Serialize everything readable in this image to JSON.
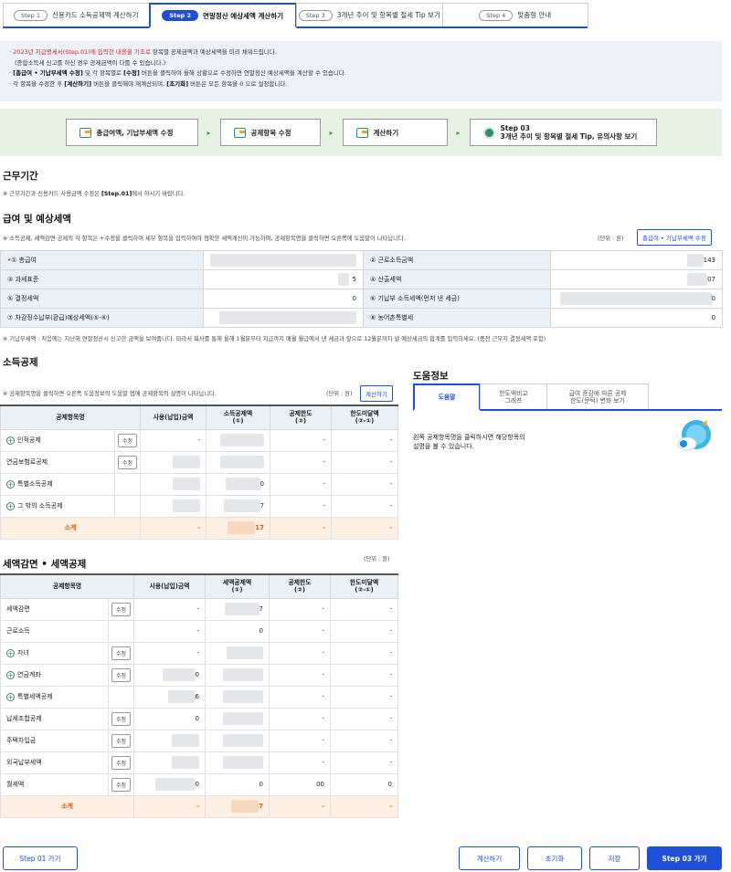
{
  "tabs": [
    {
      "step": "Step 1",
      "label": "신용카드 소득공제액 계산하기"
    },
    {
      "step": "Step 2",
      "label": "연말정산 예상세액 계산하기"
    },
    {
      "step": "Step 3",
      "label": "3개년 추이 및 항목별 절세 Tip 보기"
    },
    {
      "step": "Step 4",
      "label": "맞춤형 안내"
    }
  ],
  "notice": {
    "l1_red": "2023년 지급명세서(Step.01)에 입력한 내용을 기초로",
    "l1_rest": " 항목별 공제금액과 예상세액을 미리 채워드립니다.",
    "l2": "(종합소득세 신고를 하신 경우 공제금액이 다를 수 있습니다.)",
    "l3_b1": "[총급여 • 기납부세액 수정]",
    "l3_m1": " 및 각 항목별로 ",
    "l3_b2": "[수정]",
    "l3_m2": " 버튼을 클릭하여 올해 상황으로 수정하면 연말정산 예상세액을 계산할 수 있습니다.",
    "l4_a": "각 항목을 수정한 후 ",
    "l4_b1": "[계산하기]",
    "l4_m": " 버튼을 클릭해야 재계산되며, ",
    "l4_b2": "[초기화]",
    "l4_c": " 버튼은 모든 항목을 0 으로 설정합니다."
  },
  "flow": {
    "b1": "총급여액, 기납부세액 수정",
    "b2": "공제항목 수정",
    "b3": "계산하기",
    "b4_top": "Step 03",
    "b4_bot": "3개년 추이 및 항목별 절세 Tip, 유의사항 보기"
  },
  "work": {
    "title": "근무기간",
    "note_a": "※ 근무기간과 신용카드 사용금액 수정은 ",
    "note_b": "[Step.01]",
    "note_c": "에서 하시기 바랍니다."
  },
  "salary": {
    "title": "급여 및 예상세액",
    "note": "※ 소득공제, 세액감면·공제의 각 항목은 +수정을 클릭하여 세부 항목을 입력하여야 정확한 세액계산이 가능하며, 공제항목명을 클릭하면 오른쪽에 도움말이 나타납니다.",
    "unit": "(단위 : 원)",
    "edit_btn": "총급여 • 기납부세액 수정",
    "rows": [
      {
        "l1": "① 총급여",
        "v1": "",
        "l2": "② 근로소득금액",
        "v2": "143"
      },
      {
        "l1": "③ 과세표준",
        "v1": "5",
        "l2": "④ 산출세액",
        "v2": "07"
      },
      {
        "l1": "⑤ 결정세액",
        "v1": "0",
        "l2": "⑥ 기납부 소득세액(먼저 낸 세금)",
        "v2": "0"
      },
      {
        "l1": "⑦ 차감징수납부(환급)예상세액(⑤-⑥)",
        "v1": "",
        "l2": "⑧ 농어촌특별세",
        "v2": "0"
      }
    ],
    "star": "•",
    "footnote": "※ 기납부세액 : 처음에는 지난해 연말정산시 신고한 금액을 보여줍니다. 따라서 회사를 통해 올해 1월분부터 지급까지 매월 월급에서 낸 세금과 앞으로 12월분까지 낼 예상세금의 합계를 입력하세요. (중전 근무지 결정세액 포함)"
  },
  "income": {
    "title": "소득공제",
    "note": "※ 공제항목명을 클릭하면 오른쪽 도움정보의 도움말 탭에 공제항목의 설명이 나타납니다.",
    "unit": "(단위 : 원)",
    "calc_btn": "계산하기",
    "headers": [
      "공제항목명",
      "사용(납입)금액",
      "소득공제액\n(①)",
      "공제한도\n(②)",
      "한도미달액\n(②-①)"
    ],
    "rows": [
      {
        "name": "인적공제",
        "plus": true,
        "edit": "수정",
        "used": "-",
        "amt": "",
        "limit": "-",
        "short": "-"
      },
      {
        "name": "연금보험료공제",
        "plus": false,
        "edit": "수정",
        "used": "",
        "amt": "",
        "limit": "-",
        "short": "-"
      },
      {
        "name": "특별소득공제",
        "plus": true,
        "edit": "",
        "used": "",
        "amt": "0",
        "limit": "-",
        "short": "-"
      },
      {
        "name": "그 밖의 소득공제",
        "plus": true,
        "edit": "",
        "used": "",
        "amt": "7",
        "limit": "-",
        "short": "-"
      }
    ],
    "subtotal": {
      "label": "소계",
      "used": "-",
      "amt": "17",
      "limit": "-",
      "short": "-"
    }
  },
  "tax": {
    "title": "세액감면 • 세액공제",
    "unit": "(단위 : 원)",
    "headers": [
      "공제항목명",
      "사용(납입)금액",
      "세액공제액\n(①)",
      "공제한도\n(②)",
      "한도미달액\n(②-①)"
    ],
    "rows": [
      {
        "name": "세액감면",
        "plus": false,
        "edit": "수정",
        "used": "-",
        "amt": "7",
        "limit": "-",
        "short": "-"
      },
      {
        "name": "근로소득",
        "plus": false,
        "edit": "",
        "used": "-",
        "amt": "0",
        "limit": "-",
        "short": "-"
      },
      {
        "name": "자녀",
        "plus": true,
        "edit": "수정",
        "used": "-",
        "amt": "",
        "limit": "-",
        "short": "-"
      },
      {
        "name": "연금계좌",
        "plus": true,
        "edit": "수정",
        "used": "0",
        "amt": "",
        "limit": "-",
        "short": "-"
      },
      {
        "name": "특별세액공제",
        "plus": true,
        "edit": "",
        "used": "6",
        "amt": "",
        "limit": "-",
        "short": "-"
      },
      {
        "name": "납세조합공제",
        "plus": false,
        "edit": "수정",
        "used": "0",
        "amt": "",
        "limit": "-",
        "short": "-"
      },
      {
        "name": "주택차입금",
        "plus": false,
        "edit": "수정",
        "used": "",
        "amt": "",
        "limit": "-",
        "short": "-"
      },
      {
        "name": "외국납부세액",
        "plus": false,
        "edit": "수정",
        "used": "",
        "amt": "",
        "limit": "-",
        "short": "-"
      },
      {
        "name": "월세액",
        "plus": false,
        "edit": "수정",
        "used": "0",
        "amt": "0",
        "limit": "00",
        "short": "0"
      }
    ],
    "subtotal": {
      "label": "소계",
      "used": "-",
      "amt": "7",
      "limit": "-",
      "short": "-"
    }
  },
  "help": {
    "title": "도움정보",
    "tabs": [
      "도움말",
      "한도액비교\n그래프",
      "급여 증감에 따른 공제\n한도(문턱) 변화 보기"
    ],
    "text": "왼쪽 공제항목명을 클릭하시면 해당항목의\n설명을 볼 수 있습니다."
  },
  "buttons": {
    "prev": "Step 01 가기",
    "calc": "계산하기",
    "reset": "초기화",
    "save": "저장",
    "next": "Step 03 가기"
  }
}
